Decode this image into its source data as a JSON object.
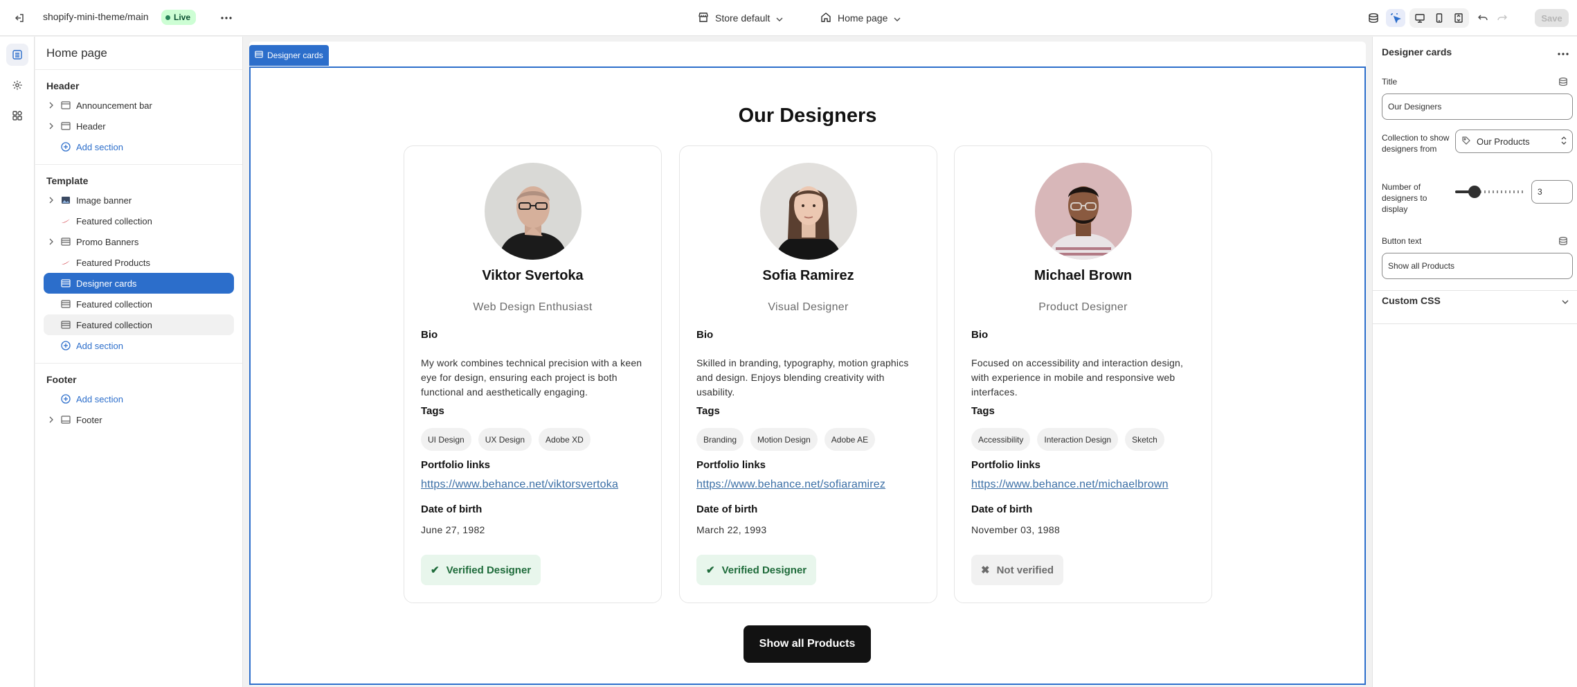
{
  "topbar": {
    "theme_name": "shopify-mini-theme/main",
    "live_label": "Live",
    "store_label": "Store default",
    "page_label": "Home page",
    "save_label": "Save"
  },
  "left_panel": {
    "title": "Home page",
    "header_group": {
      "title": "Header",
      "items": [
        "Announcement bar",
        "Header"
      ],
      "add_label": "Add section"
    },
    "template_group": {
      "title": "Template",
      "items": [
        "Image banner",
        "Featured collection",
        "Promo Banners",
        "Featured Products",
        "Designer cards",
        "Featured collection",
        "Featured collection"
      ],
      "add_label": "Add section"
    },
    "footer_group": {
      "title": "Footer",
      "add_label": "Add section",
      "items": [
        "Footer"
      ]
    }
  },
  "preview": {
    "section_tag": "Designer cards",
    "heading": "Our Designers",
    "labels": {
      "bio": "Bio",
      "tags": "Tags",
      "portfolio": "Portfolio links",
      "dob": "Date of birth"
    },
    "designers": [
      {
        "name": "Viktor Svertoka",
        "role": "Web Design Enthusiast",
        "bio": "My work combines technical precision with a keen eye for design, ensuring each project is both functional and aesthetically engaging.",
        "tags": [
          "UI Design",
          "UX Design",
          "Adobe XD"
        ],
        "link": "https://www.behance.net/viktorsvertoka",
        "dob": "June 27, 1982",
        "status": "Verified Designer",
        "status_icon": "✔",
        "verified": true
      },
      {
        "name": "Sofia Ramirez",
        "role": "Visual Designer",
        "bio": "Skilled in branding, typography, motion graphics and design. Enjoys blending creativity with usability.",
        "tags": [
          "Branding",
          "Motion Design",
          "Adobe AE"
        ],
        "link": "https://www.behance.net/sofiaramirez",
        "dob": "March 22, 1993",
        "status": "Verified Designer",
        "status_icon": "✔",
        "verified": true
      },
      {
        "name": "Michael Brown",
        "role": "Product Designer",
        "bio": "Focused on accessibility and interaction design, with experience in mobile and responsive web interfaces.",
        "tags": [
          "Accessibility",
          "Interaction Design",
          "Sketch"
        ],
        "link": "https://www.behance.net/michaelbrown",
        "dob": "November 03, 1988",
        "status": "Not verified",
        "status_icon": "✖",
        "verified": false
      }
    ],
    "button_label": "Show all Products"
  },
  "right_panel": {
    "title": "Designer cards",
    "title_label": "Title",
    "title_value": "Our Designers",
    "collection_label": "Collection to show designers from",
    "collection_value": "Our Products",
    "count_label": "Number of designers to display",
    "count_value": "3",
    "count_level": 3,
    "button_label": "Button text",
    "button_value": "Show all Products",
    "custom_css_label": "Custom CSS"
  },
  "colors": {
    "accent": "#2c6ecb",
    "verified_bg": "#e8f6ec",
    "verified_text": "#1e6b3a",
    "cta_bg": "#121212"
  }
}
